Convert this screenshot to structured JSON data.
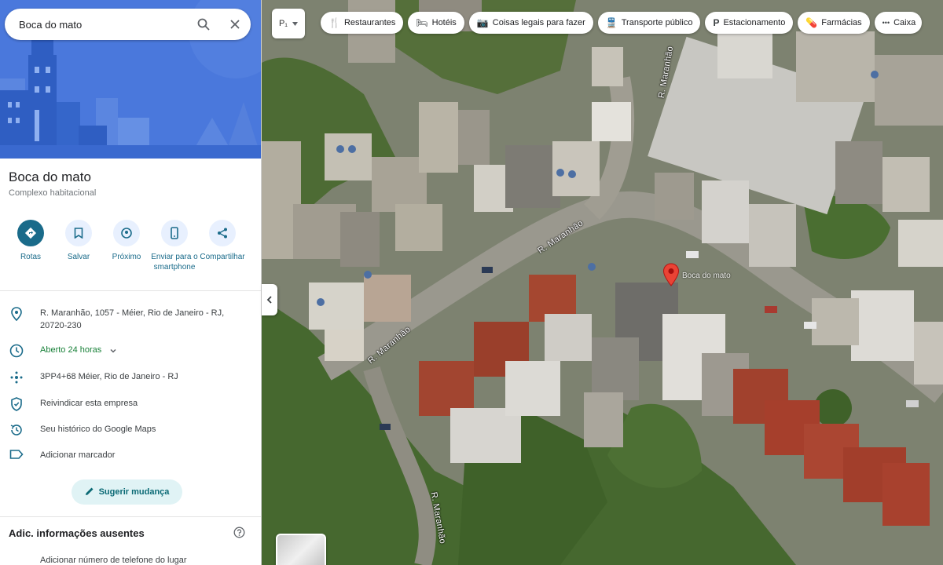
{
  "search": {
    "query": "Boca do mato",
    "search_icon": "search-icon",
    "close_icon": "close-icon"
  },
  "place": {
    "title": "Boca do mato",
    "category": "Complexo habitacional"
  },
  "actions": [
    {
      "label": "Rotas",
      "icon": "directions-icon"
    },
    {
      "label": "Salvar",
      "icon": "bookmark-icon"
    },
    {
      "label": "Próximo",
      "icon": "nearby-icon"
    },
    {
      "label": "Enviar para o smartphone",
      "icon": "phone-icon"
    },
    {
      "label": "Compartilhar",
      "icon": "share-icon"
    }
  ],
  "info": {
    "address": "R. Maranhão, 1057 - Méier, Rio de Janeiro - RJ, 20720-230",
    "hours": "Aberto 24 horas",
    "plus_code": "3PP4+68 Méier, Rio de Janeiro - RJ",
    "claim": "Reivindicar esta empresa",
    "history": "Seu histórico do Google Maps",
    "label": "Adicionar marcador"
  },
  "suggest_label": "Sugerir mudança",
  "missing": {
    "title": "Adic. informações ausentes",
    "item": "Adicionar número de telefone do lugar"
  },
  "map": {
    "layers_label": "P₁",
    "chips": [
      {
        "label": "Restaurantes",
        "icon": "restaurant-icon",
        "glyph": "🍴"
      },
      {
        "label": "Hotéis",
        "icon": "hotel-icon",
        "glyph": "🛏"
      },
      {
        "label": "Coisas legais para fazer",
        "icon": "camera-icon",
        "glyph": "📷"
      },
      {
        "label": "Transporte público",
        "icon": "transit-icon",
        "glyph": "🚆"
      },
      {
        "label": "Estacionamento",
        "icon": "parking-icon",
        "glyph": "P"
      },
      {
        "label": "Farmácias",
        "icon": "pharmacy-icon",
        "glyph": "💊"
      },
      {
        "label": "Caixa",
        "icon": "atm-icon",
        "glyph": "•••"
      }
    ],
    "pin_label": "Boca do mato",
    "road_labels": [
      "R. Maranhão",
      "R. Maranhão",
      "R. Maranhão",
      "R. Maranhão"
    ]
  },
  "colors": {
    "accent": "#1a6b8a",
    "hero_blue": "#3f6fd8",
    "pin_red": "#ea4335",
    "hours_green": "#188038"
  }
}
